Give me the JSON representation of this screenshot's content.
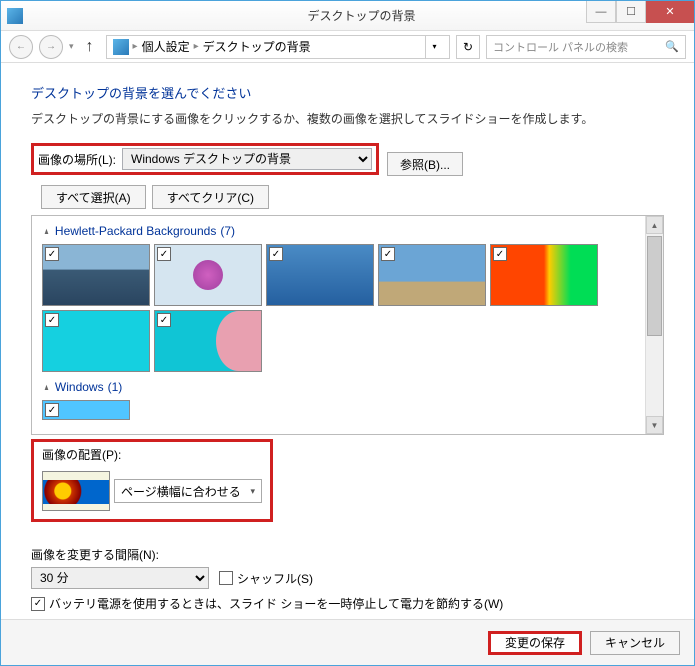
{
  "titlebar": {
    "title": "デスクトップの背景"
  },
  "breadcrumb": {
    "item1": "個人設定",
    "item2": "デスクトップの背景"
  },
  "search": {
    "placeholder": "コントロール パネルの検索"
  },
  "heading": "デスクトップの背景を選んでください",
  "subtext": "デスクトップの背景にする画像をクリックするか、複数の画像を選択してスライドショーを作成します。",
  "location": {
    "label": "画像の場所(L):",
    "value": "Windows デスクトップの背景",
    "browse": "参照(B)..."
  },
  "select_all": "すべて選択(A)",
  "clear_all": "すべてクリア(C)",
  "group1": {
    "name": "Hewlett-Packard Backgrounds",
    "count": "(7)"
  },
  "group2": {
    "name": "Windows",
    "count": "(1)"
  },
  "placement": {
    "label": "画像の配置(P):",
    "value": "ページ横幅に合わせる"
  },
  "interval": {
    "label": "画像を変更する間隔(N):",
    "value": "30 分"
  },
  "shuffle": "シャッフル(S)",
  "battery": "バッテリ電源を使用するときは、スライド ショーを一時停止して電力を節約する(W)",
  "save": "変更の保存",
  "cancel": "キャンセル"
}
